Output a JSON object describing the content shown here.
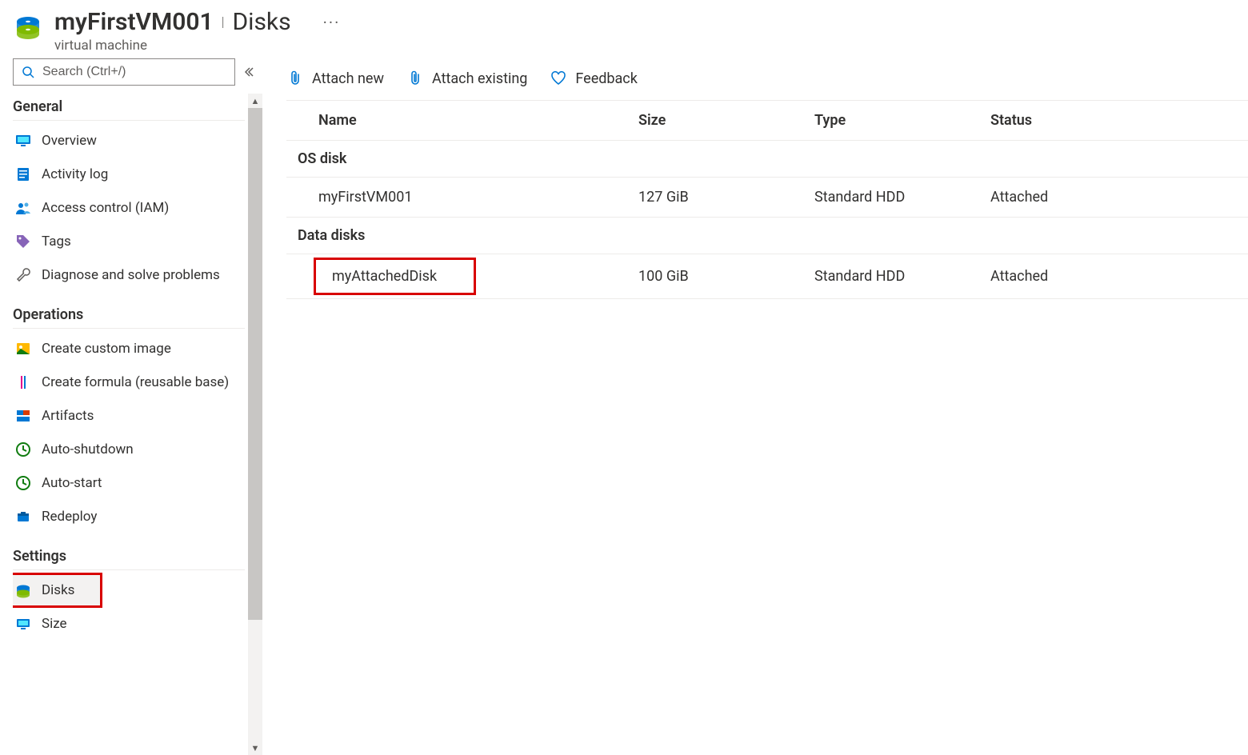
{
  "header": {
    "title": "myFirstVM001",
    "section": "Disks",
    "subtitle": "virtual machine"
  },
  "sidebar": {
    "search_placeholder": "Search (Ctrl+/)",
    "sections": {
      "general": "General",
      "operations": "Operations",
      "settings": "Settings"
    },
    "items": {
      "general": [
        {
          "label": "Overview",
          "icon": "monitor"
        },
        {
          "label": "Activity log",
          "icon": "log"
        },
        {
          "label": "Access control (IAM)",
          "icon": "people"
        },
        {
          "label": "Tags",
          "icon": "tag"
        },
        {
          "label": "Diagnose and solve problems",
          "icon": "wrench"
        }
      ],
      "operations": [
        {
          "label": "Create custom image",
          "icon": "image"
        },
        {
          "label": "Create formula (reusable base)",
          "icon": "flask"
        },
        {
          "label": "Artifacts",
          "icon": "artifacts"
        },
        {
          "label": "Auto-shutdown",
          "icon": "clock"
        },
        {
          "label": "Auto-start",
          "icon": "clock"
        },
        {
          "label": "Redeploy",
          "icon": "redeploy"
        }
      ],
      "settings": [
        {
          "label": "Disks",
          "icon": "disk",
          "selected": true,
          "highlight": true
        },
        {
          "label": "Size",
          "icon": "size"
        }
      ]
    }
  },
  "toolbar": {
    "attach_new": "Attach new",
    "attach_existing": "Attach existing",
    "feedback": "Feedback"
  },
  "table": {
    "headers": {
      "name": "Name",
      "size": "Size",
      "type": "Type",
      "status": "Status"
    },
    "groups": [
      {
        "label": "OS disk",
        "rows": [
          {
            "name": "myFirstVM001",
            "size": "127 GiB",
            "type": "Standard HDD",
            "status": "Attached"
          }
        ]
      },
      {
        "label": "Data disks",
        "rows": [
          {
            "name": "myAttachedDisk",
            "size": "100 GiB",
            "type": "Standard HDD",
            "status": "Attached",
            "highlight": true
          }
        ]
      }
    ]
  }
}
